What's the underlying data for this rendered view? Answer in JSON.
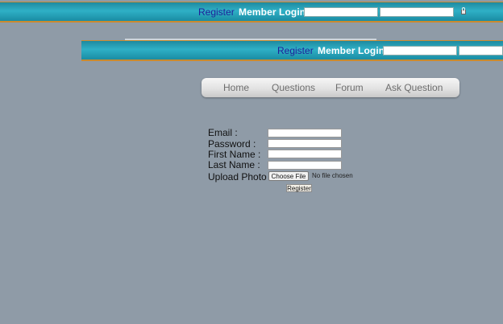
{
  "top_bar": {
    "register_label": "Register",
    "member_login_label": "Member Login:"
  },
  "secondary_bar": {
    "register_label": "Register",
    "member_login_label": "Member Login:"
  },
  "nav": {
    "items": [
      "Home",
      "Questions",
      "Forum",
      "Ask Question"
    ]
  },
  "form": {
    "email_label": "Email :",
    "password_label": "Password :",
    "first_name_label": "First Name :",
    "last_name_label": "Last Name :",
    "upload_photo_label": "Upload Photo :",
    "choose_file_label": "Choose File",
    "no_file_text": "No file chosen",
    "submit_label": "Register"
  },
  "colors": {
    "page_background": "#8f9ba7",
    "bar_teal": "#2fb0c6",
    "bar_border_orange": "#c98a2f",
    "register_link": "#1f1f9a"
  }
}
